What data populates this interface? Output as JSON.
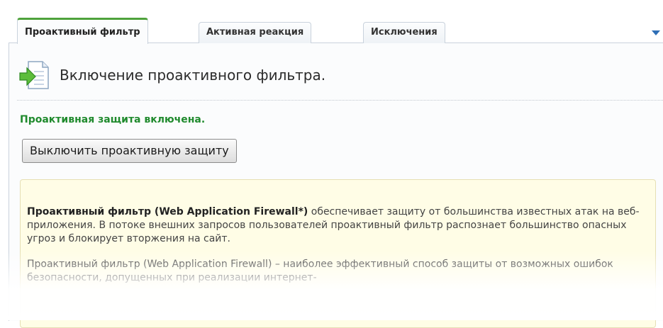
{
  "tabs": [
    {
      "label": "Проактивный фильтр",
      "active": true
    },
    {
      "label": "Активная реакция",
      "active": false
    },
    {
      "label": "Исключения",
      "active": false
    }
  ],
  "heading": {
    "icon": "document-arrow-icon",
    "title": "Включение проактивного фильтра."
  },
  "status": {
    "text": "Проактивная защита включена.",
    "color": "#1f8a2d"
  },
  "toggle_button": {
    "label": "Выключить проактивную защиту"
  },
  "info": {
    "p1_bold": "Проактивный фильтр (Web Application Firewall*)",
    "p1_text": " обеспечивает защиту от большинства известных атак на веб-приложения. В потоке внешних запросов пользователей проактивный фильтр распознает большинство опасных угроз и блокирует вторжения на сайт.",
    "p2_text": "Проактивный фильтр (Web Application Firewall) – наиболее эффективный способ защиты от возможных ошибок безопасности, допущенных при реализации интернет-"
  },
  "colors": {
    "active_tab_border": "#4fa23c",
    "info_background": "#fffde6",
    "dropdown_arrow": "#2f6fb6"
  }
}
